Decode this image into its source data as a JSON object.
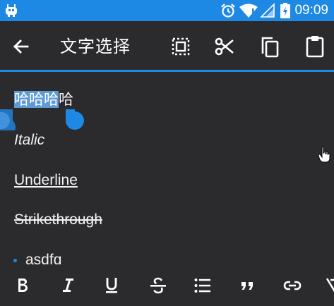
{
  "status_bar": {
    "time": "09:09",
    "icons": [
      "app-notification-icon",
      "alarm-icon",
      "wifi-icon",
      "signal-icon",
      "battery-icon"
    ],
    "background_color": "#1e88e5"
  },
  "toolbar": {
    "title": "文字选择",
    "buttons": [
      "back-icon",
      "select-all-icon",
      "cut-icon",
      "copy-icon",
      "paste-icon"
    ],
    "accent_color": "#1e88e5"
  },
  "editor": {
    "line1_selected": "哈哈哈",
    "line1_rest": "哈",
    "line2": "Italic",
    "line3": "Underline",
    "line4": "Strikethrough",
    "bullet_item": "asdfg",
    "selection_color": "#5d9ad6"
  },
  "format_bar": {
    "buttons": [
      "bold-icon",
      "italic-icon",
      "underline-icon",
      "strikethrough-icon",
      "bullet-list-icon",
      "quote-icon",
      "link-icon",
      "clear-format-icon"
    ]
  }
}
